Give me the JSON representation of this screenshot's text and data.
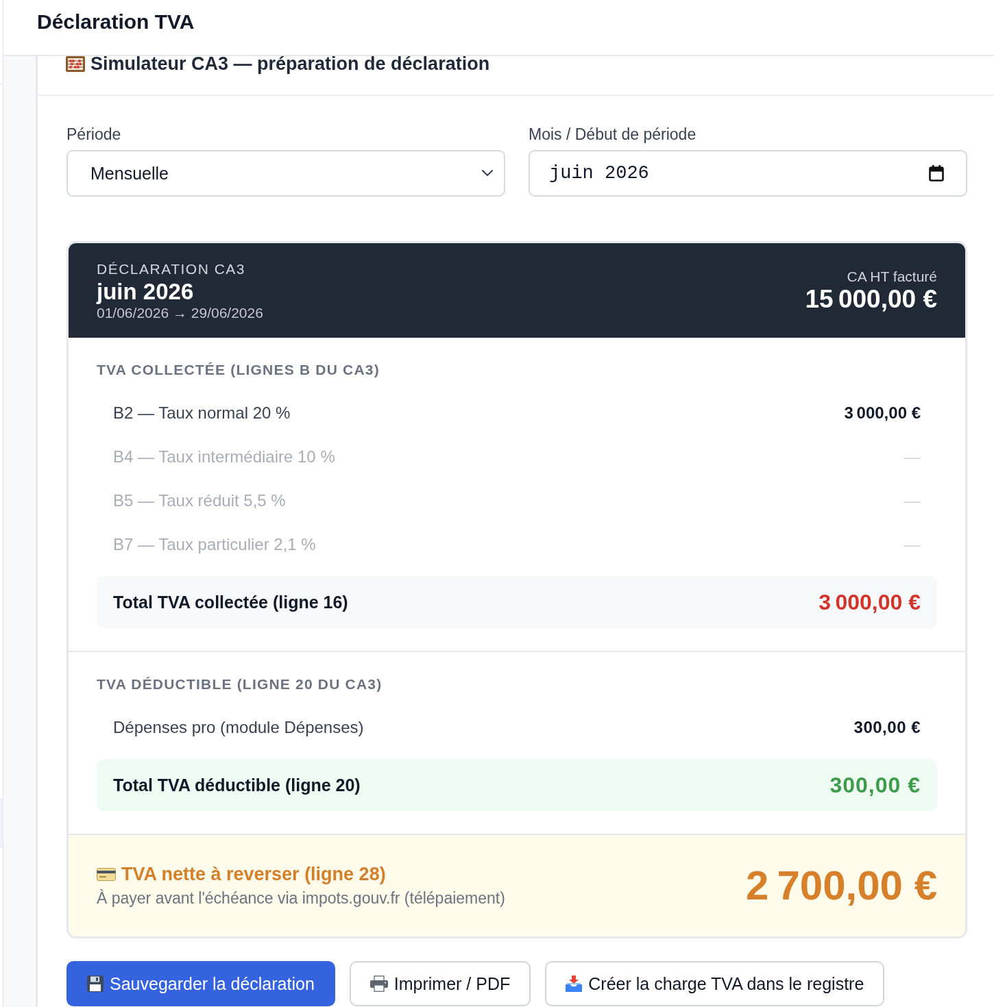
{
  "header": {
    "title": "Déclaration TVA"
  },
  "card": {
    "title": "Simulateur CA3 — préparation de déclaration"
  },
  "form": {
    "fields": [
      {
        "kind": "select",
        "label": "Période",
        "value": "Mensuelle"
      },
      {
        "kind": "month",
        "label": "Mois / Début de période",
        "value": "juin 2026"
      }
    ]
  },
  "summary": {
    "eyebrow": "DÉCLARATION CA3",
    "period": "juin 2026",
    "range": "01/06/2026 → 29/06/2026",
    "revenue_label": "CA HT facturé",
    "revenue": "15 000,00 €"
  },
  "sections": [
    {
      "kind": "collected",
      "heading": "TVA COLLECTÉE (LIGNES B DU CA3)",
      "rows": [
        {
          "label": "B2 — Taux normal 20 %",
          "amount": "3 000,00 €",
          "disabled": false
        },
        {
          "label": "B4 — Taux intermédiaire 10 %",
          "amount": "—",
          "disabled": true
        },
        {
          "label": "B5 — Taux réduit 5,5 %",
          "amount": "—",
          "disabled": true
        },
        {
          "label": "B7 — Taux particulier 2,1 %",
          "amount": "—",
          "disabled": true
        }
      ],
      "total": {
        "label": "Total TVA collectée (ligne 16)",
        "amount": "3 000,00 €"
      }
    },
    {
      "kind": "deductible",
      "heading": "TVA DÉDUCTIBLE (LIGNE 20 DU CA3)",
      "rows": [
        {
          "label": "Dépenses pro (module Dépenses)",
          "amount": "300,00 €",
          "disabled": false
        }
      ],
      "total": {
        "label": "Total TVA déductible (ligne 20)",
        "amount": "300,00 €"
      }
    }
  ],
  "net": {
    "title": "TVA nette à reverser (ligne 28)",
    "note": "À payer avant l'échéance via impots.gouv.fr (télépaiement)",
    "amount": "2 700,00 €"
  },
  "buttons": [
    {
      "kind": "primary",
      "label": "Sauvegarder la déclaration"
    },
    {
      "kind": "secondary",
      "label": "Imprimer / PDF"
    },
    {
      "kind": "secondary",
      "label": "Créer la charge TVA dans le registre"
    }
  ]
}
